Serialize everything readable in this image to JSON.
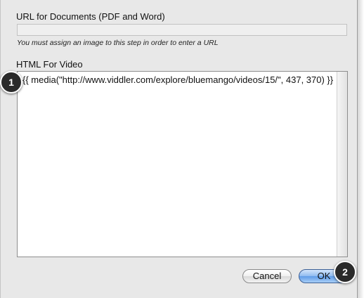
{
  "url_section": {
    "label": "URL for Documents (PDF and Word)",
    "value": "",
    "hint": "You must assign an image to this step in order to enter a URL"
  },
  "video_section": {
    "label": "HTML For Video",
    "value": "{{ media(\"http://www.viddler.com/explore/bluemango/videos/15/\", 437, 370) }}"
  },
  "buttons": {
    "cancel_label": "Cancel",
    "ok_label": "OK"
  },
  "markers": {
    "step1": "1",
    "step2": "2"
  },
  "colors": {
    "dialog_background": "#e8e8e8",
    "ok_button": "#5e9be8",
    "marker": "#2a2a2a"
  }
}
